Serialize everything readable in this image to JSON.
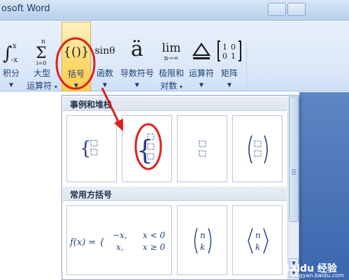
{
  "window": {
    "title": "osoft Word"
  },
  "ribbon": {
    "groups": [
      {
        "glyph": "∫ₓ",
        "label1": "积分",
        "label2": ""
      },
      {
        "glyph": "Σ",
        "label1": "大型",
        "label2": "运算符"
      },
      {
        "glyph": "{()}",
        "label1": "括号",
        "label2": ""
      },
      {
        "glyph": "sinθ",
        "label1": "函数",
        "label2": ""
      },
      {
        "glyph": "ä",
        "label1": "导数符号",
        "label2": ""
      },
      {
        "glyph": "lim",
        "label1": "极限和",
        "label2": "对数"
      },
      {
        "glyph": "Δ",
        "label1": "运算符",
        "label2": ""
      },
      {
        "glyph": "[10 01]",
        "label1": "矩阵",
        "label2": ""
      }
    ],
    "integral_limits": {
      "upper": "x",
      "lower": "-x"
    },
    "sum_limits": {
      "upper": "n",
      "lower": "i=0"
    },
    "lim_sub": "n→∞"
  },
  "gallery": {
    "section1_title": "事例和堆栈",
    "section2_title": "常用方括号",
    "piecewise": {
      "lhs": "f(x) = {",
      "row1_a": "−x,",
      "row1_b": "x < 0",
      "row2_a": "x,",
      "row2_b": "x ≥ 0"
    },
    "binom": {
      "top": "n",
      "bottom": "k"
    }
  },
  "watermark": {
    "text": "Baidu 经验",
    "url": "jingyan.baidu.com"
  },
  "colors": {
    "accent_red": "#e0201b",
    "ribbon_text": "#1e3f78"
  }
}
